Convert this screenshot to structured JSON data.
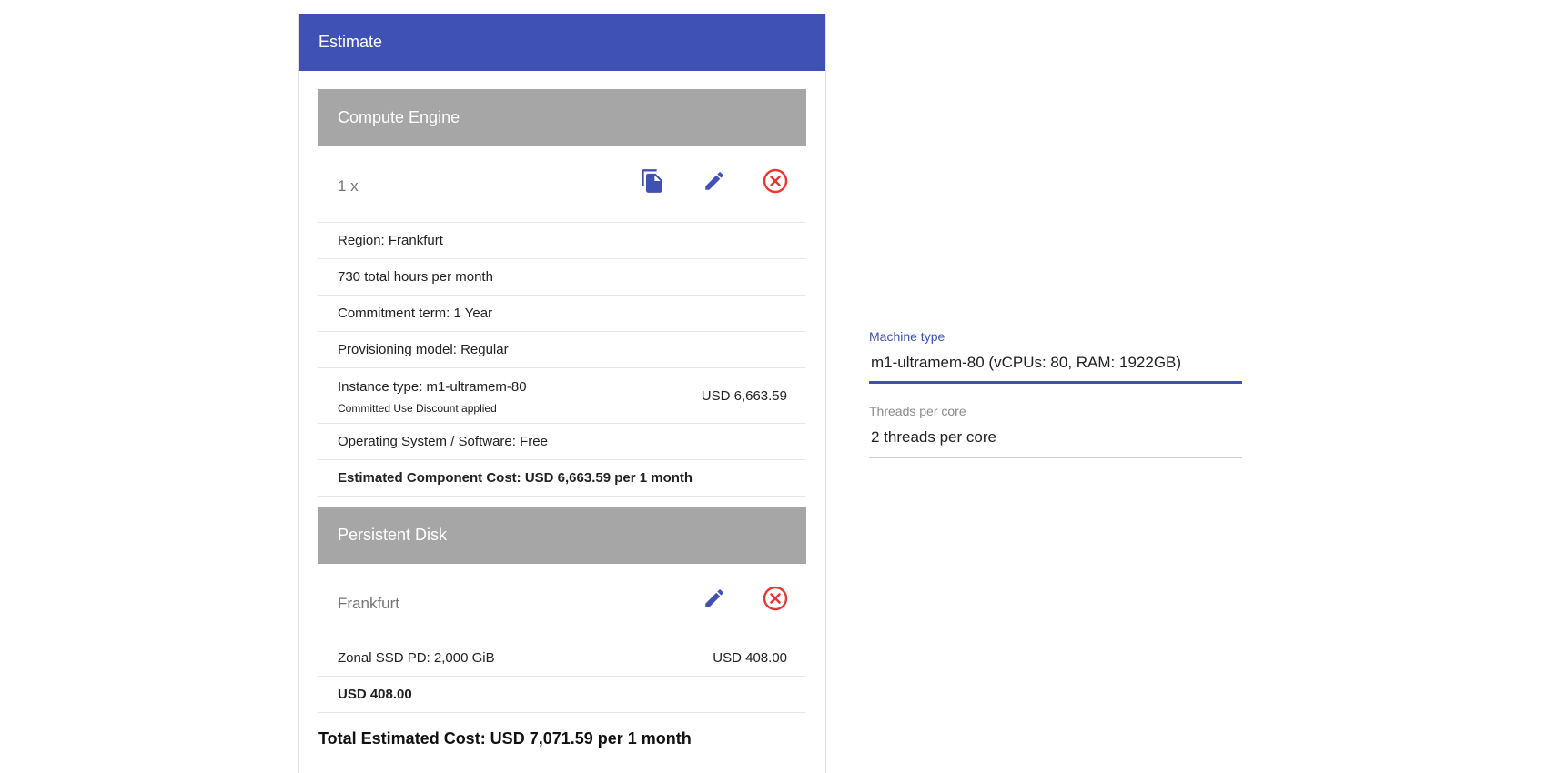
{
  "estimate": {
    "title": "Estimate",
    "compute": {
      "section_title": "Compute Engine",
      "quantity": "1 x",
      "rows": {
        "region": "Region: Frankfurt",
        "hours": "730 total hours per month",
        "commitment": "Commitment term: 1 Year",
        "provisioning": "Provisioning model: Regular",
        "instance_type": "Instance type: m1-ultramem-80",
        "discount_note": "Committed Use Discount applied",
        "instance_price": "USD 6,663.59",
        "os": "Operating System / Software: Free",
        "component_cost": "Estimated Component Cost: USD 6,663.59 per 1 month"
      }
    },
    "disk": {
      "section_title": "Persistent Disk",
      "location": "Frankfurt",
      "rows": {
        "ssd": "Zonal SSD PD: 2,000 GiB",
        "ssd_price": "USD 408.00",
        "subtotal": "USD 408.00"
      }
    },
    "total": "Total Estimated Cost: USD 7,071.59 per 1 month"
  },
  "form": {
    "machine_type": {
      "label": "Machine type",
      "value": "m1-ultramem-80 (vCPUs: 80, RAM: 1922GB)"
    },
    "threads": {
      "label": "Threads per core",
      "value": "2 threads per core"
    }
  },
  "colors": {
    "header_blue": "#3f51b5",
    "section_gray": "#a6a6a6",
    "icon_blue": "#3f51b5",
    "delete_red": "#e53935"
  },
  "icons": {
    "copy": "copy-icon",
    "edit": "edit-icon",
    "delete": "delete-icon"
  }
}
